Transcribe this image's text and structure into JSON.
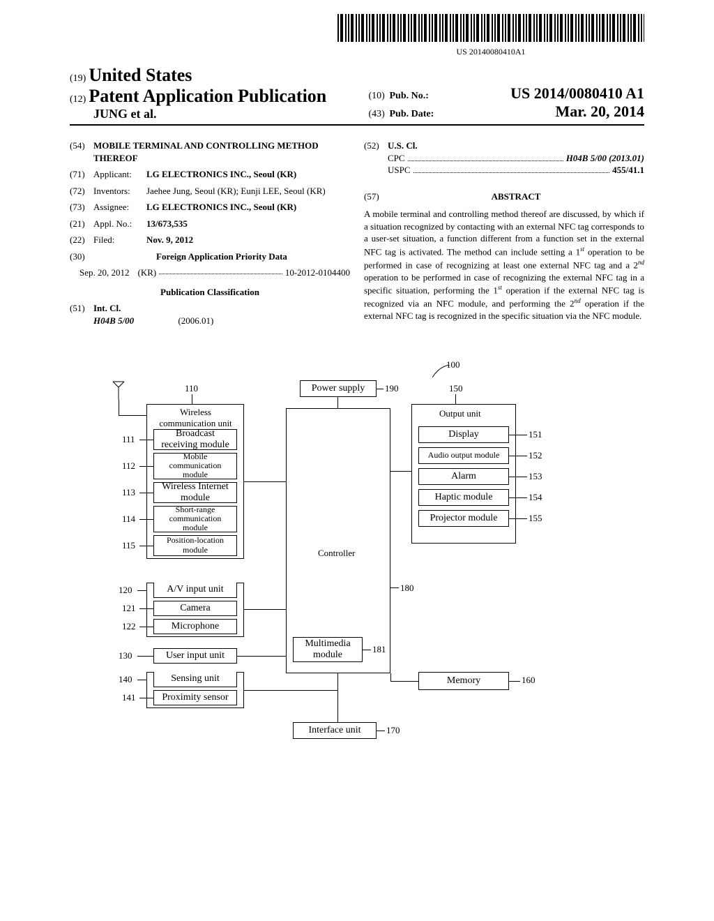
{
  "barcode_number": "US 20140080410A1",
  "header": {
    "country_num": "(19)",
    "country": "United States",
    "doc_type_num": "(12)",
    "doc_type": "Patent Application Publication",
    "authors": "JUNG et al.",
    "pub_no_num": "(10)",
    "pub_no_label": "Pub. No.:",
    "pub_no": "US 2014/0080410 A1",
    "pub_date_num": "(43)",
    "pub_date_label": "Pub. Date:",
    "pub_date": "Mar. 20, 2014"
  },
  "left": {
    "title_num": "(54)",
    "title": "MOBILE TERMINAL AND CONTROLLING METHOD THEREOF",
    "applicant_num": "(71)",
    "applicant_label": "Applicant:",
    "applicant": "LG ELECTRONICS INC., Seoul (KR)",
    "inventors_num": "(72)",
    "inventors_label": "Inventors:",
    "inventors": "Jaehee Jung, Seoul (KR); Eunji LEE, Seoul (KR)",
    "assignee_num": "(73)",
    "assignee_label": "Assignee:",
    "assignee": "LG ELECTRONICS INC., Seoul (KR)",
    "appl_num_num": "(21)",
    "appl_num_label": "Appl. No.:",
    "appl_num": "13/673,535",
    "filed_num": "(22)",
    "filed_label": "Filed:",
    "filed": "Nov. 9, 2012",
    "foreign_num": "(30)",
    "foreign_title": "Foreign Application Priority Data",
    "foreign_date": "Sep. 20, 2012",
    "foreign_country": "(KR)",
    "foreign_app": "10-2012-0104400",
    "pub_class_title": "Publication Classification",
    "intcl_num": "(51)",
    "intcl_label": "Int. Cl.",
    "intcl_code": "H04B 5/00",
    "intcl_year": "(2006.01)"
  },
  "right": {
    "uscl_num": "(52)",
    "uscl_label": "U.S. Cl.",
    "cpc_label": "CPC",
    "cpc_val": "H04B 5/00 (2013.01)",
    "uspc_label": "USPC",
    "uspc_val": "455/41.1",
    "abstract_num": "(57)",
    "abstract_title": "ABSTRACT",
    "abstract_text": "A mobile terminal and controlling method thereof are discussed, by which if a situation recognized by contacting with an external NFC tag corresponds to a user-set situation, a function different from a function set in the external NFC tag is activated. The method can include setting a 1st operation to be performed in case of recognizing at least one external NFC tag and a 2nd operation to be performed in case of recognizing the external NFC tag in a specific situation, performing the 1st operation if the external NFC tag is recognized via an NFC module, and performing the 2nd operation if the external NFC tag is recognized in the specific situation via the NFC module."
  },
  "diagram": {
    "ref_100": "100",
    "ref_110": "110",
    "ref_111": "111",
    "ref_112": "112",
    "ref_113": "113",
    "ref_114": "114",
    "ref_115": "115",
    "ref_120": "120",
    "ref_121": "121",
    "ref_122": "122",
    "ref_130": "130",
    "ref_140": "140",
    "ref_141": "141",
    "ref_150": "150",
    "ref_151": "151",
    "ref_152": "152",
    "ref_153": "153",
    "ref_154": "154",
    "ref_155": "155",
    "ref_160": "160",
    "ref_170": "170",
    "ref_180": "180",
    "ref_181": "181",
    "ref_190": "190",
    "power_supply": "Power supply",
    "wireless_comm": "Wireless communication unit",
    "broadcast": "Broadcast receiving module",
    "mobile_comm": "Mobile communication module",
    "wifi": "Wireless Internet module",
    "short_range": "Short-range communication module",
    "position": "Position-location module",
    "av_input": "A/V input unit",
    "camera": "Camera",
    "microphone": "Microphone",
    "user_input": "User input unit",
    "sensing": "Sensing unit",
    "proximity": "Proximity sensor",
    "controller": "Controller",
    "multimedia": "Multimedia module",
    "output": "Output unit",
    "display": "Display",
    "audio": "Audio output module",
    "alarm": "Alarm",
    "haptic": "Haptic module",
    "projector": "Projector module",
    "memory": "Memory",
    "interface": "Interface unit"
  }
}
